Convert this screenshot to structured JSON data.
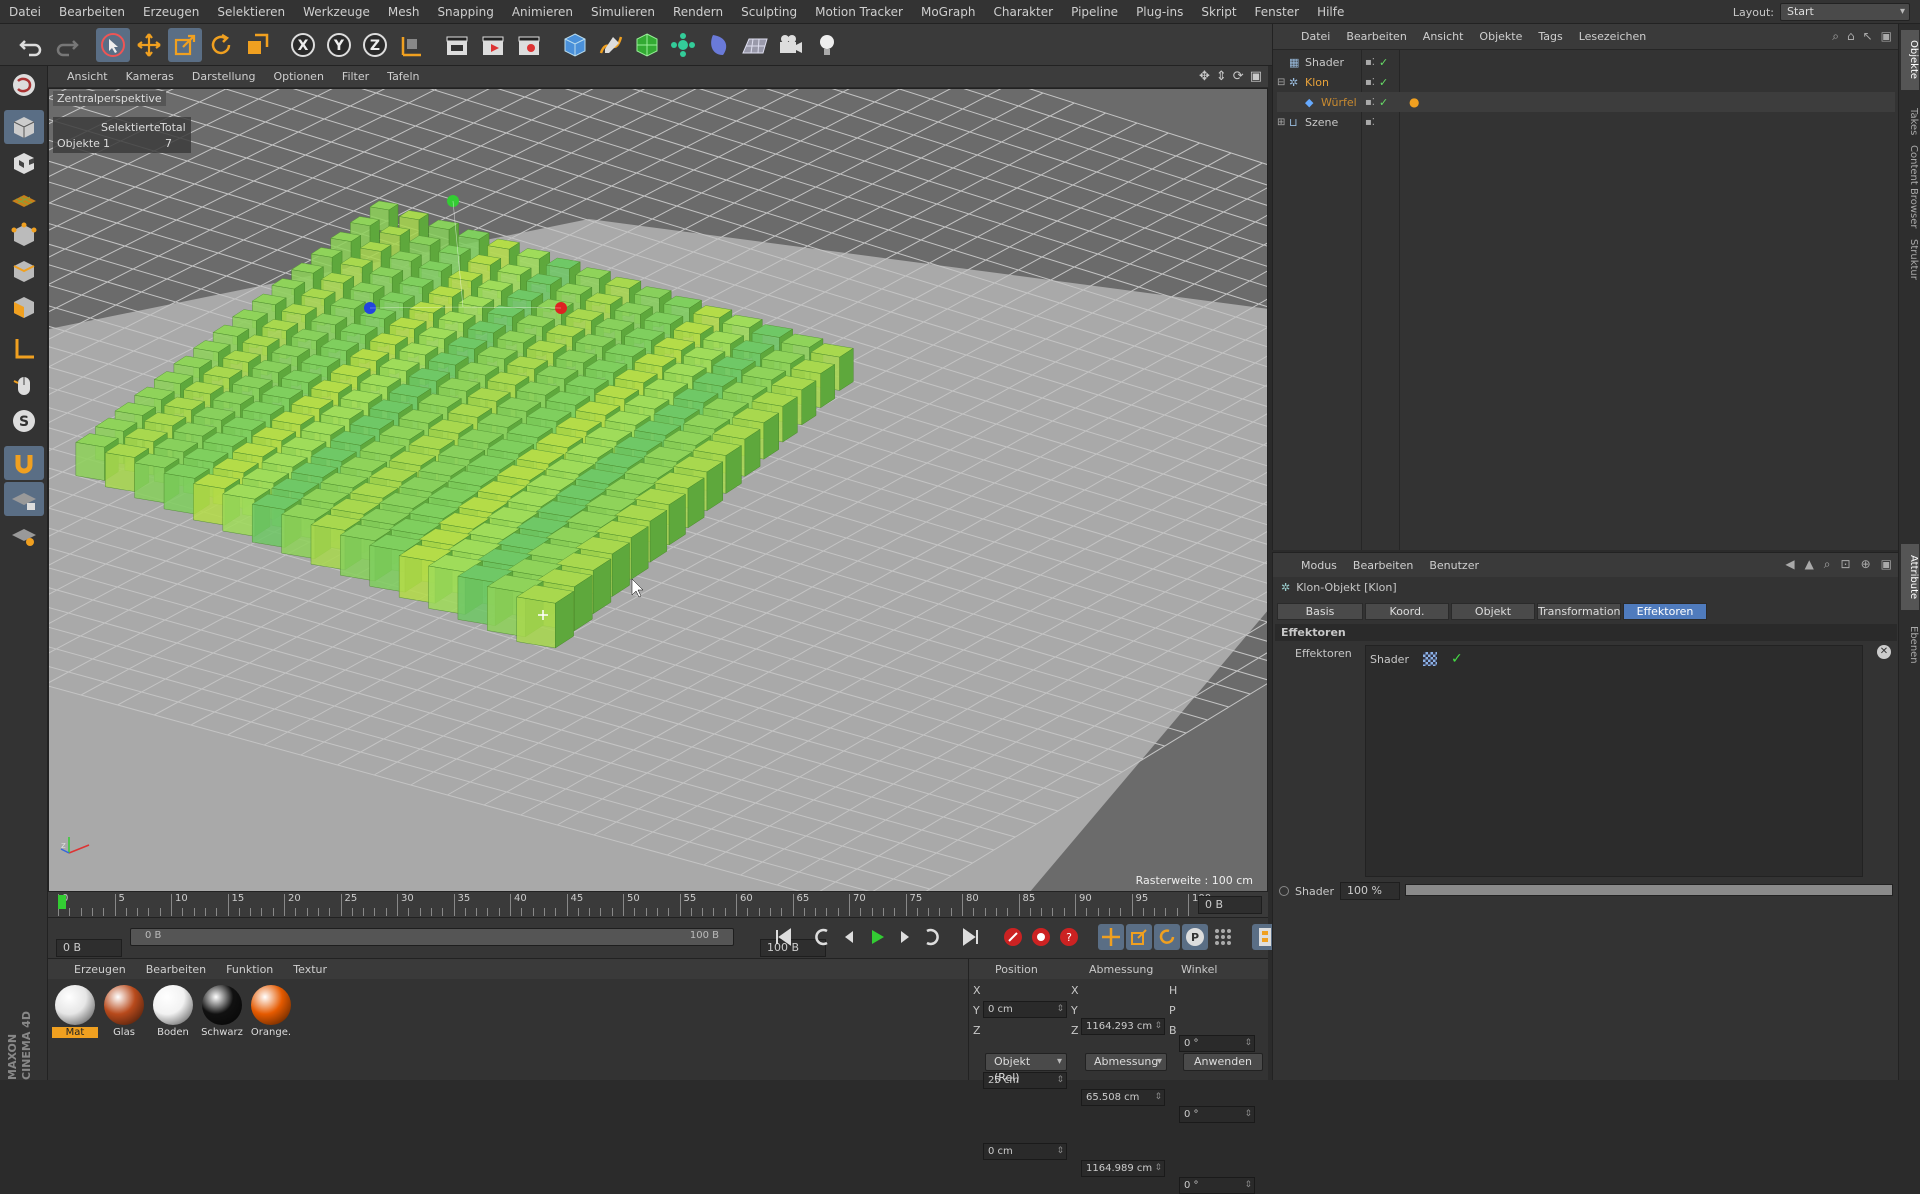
{
  "menu": [
    "Datei",
    "Bearbeiten",
    "Erzeugen",
    "Selektieren",
    "Werkzeuge",
    "Mesh",
    "Snapping",
    "Animieren",
    "Simulieren",
    "Rendern",
    "Sculpting",
    "Motion Tracker",
    "MoGraph",
    "Charakter",
    "Pipeline",
    "Plug-ins",
    "Skript",
    "Fenster",
    "Hilfe"
  ],
  "layout": {
    "label": "Layout:",
    "value": "Start"
  },
  "viewport": {
    "menu": [
      "Ansicht",
      "Kameras",
      "Darstellung",
      "Optionen",
      "Filter",
      "Tafeln"
    ],
    "label": "Zentralperspektive",
    "hud": {
      "h1": "Selektierte",
      "h2": "Total",
      "row_label": "Objekte",
      "selected": "1",
      "total": "7"
    },
    "raster": "Rasterweite : 100 cm"
  },
  "timeline": {
    "ticks": [
      "0",
      "5",
      "10",
      "15",
      "20",
      "25",
      "30",
      "35",
      "40",
      "45",
      "50",
      "55",
      "60",
      "65",
      "70",
      "75",
      "80",
      "85",
      "90",
      "95",
      "100"
    ],
    "frame_end": "0 B",
    "current_frame": 0
  },
  "transport": {
    "start": "0 B",
    "range_start": "0 B",
    "range_end": "100 B",
    "end": "100 B"
  },
  "materials": {
    "menu": [
      "Erzeugen",
      "Bearbeiten",
      "Funktion",
      "Textur"
    ],
    "items": [
      {
        "name": "Mat",
        "color": "#e6e6e6"
      },
      {
        "name": "Glas",
        "color": "#b84a1c"
      },
      {
        "name": "Boden",
        "color": "#f2f2f2"
      },
      {
        "name": "Schwarz",
        "color": "#111111"
      },
      {
        "name": "Orange.",
        "color": "#e55a00"
      }
    ]
  },
  "coords": {
    "headers": [
      "Position",
      "Abmessung",
      "Winkel"
    ],
    "rows": [
      {
        "axis": "X",
        "pos": "0 cm",
        "size_axis": "X",
        "size": "1164.293 cm",
        "rot_axis": "H",
        "rot": "0 °"
      },
      {
        "axis": "Y",
        "pos": "25 cm",
        "size_axis": "Y",
        "size": "65.508 cm",
        "rot_axis": "P",
        "rot": "0 °"
      },
      {
        "axis": "Z",
        "pos": "0 cm",
        "size_axis": "Z",
        "size": "1164.989 cm",
        "rot_axis": "B",
        "rot": "0 °"
      }
    ],
    "mode": "Objekt (Rel)",
    "size_mode": "Abmessung",
    "apply": "Anwenden"
  },
  "objects": {
    "menu": [
      "Datei",
      "Bearbeiten",
      "Ansicht",
      "Objekte",
      "Tags",
      "Lesezeichen"
    ],
    "items": [
      {
        "name": "Shader",
        "color": "#c8c8c8"
      },
      {
        "name": "Klon",
        "color": "#e8a23a"
      },
      {
        "name": "Würfel",
        "color": "#c88a30"
      },
      {
        "name": "Szene",
        "color": "#c8c8c8"
      }
    ]
  },
  "attributes": {
    "menu": [
      "Modus",
      "Bearbeiten",
      "Benutzer"
    ],
    "title": "Klon-Objekt [Klon]",
    "tabs": [
      "Basis",
      "Koord.",
      "Objekt",
      "Transformation",
      "Effektoren"
    ],
    "section": "Effektoren",
    "field_label": "Effektoren",
    "effector": "Shader",
    "strength_label": "Shader",
    "strength_value": "100 %",
    "strength": 1.0
  },
  "right_tabs": [
    "Objekte",
    "Takes",
    "Content Browser",
    "Struktur",
    "Attribute",
    "Ebenen"
  ],
  "brand": "MAXON CINEMA 4D",
  "colors": {
    "accent": "#4f7bbd",
    "selection": "#e8a23a"
  }
}
